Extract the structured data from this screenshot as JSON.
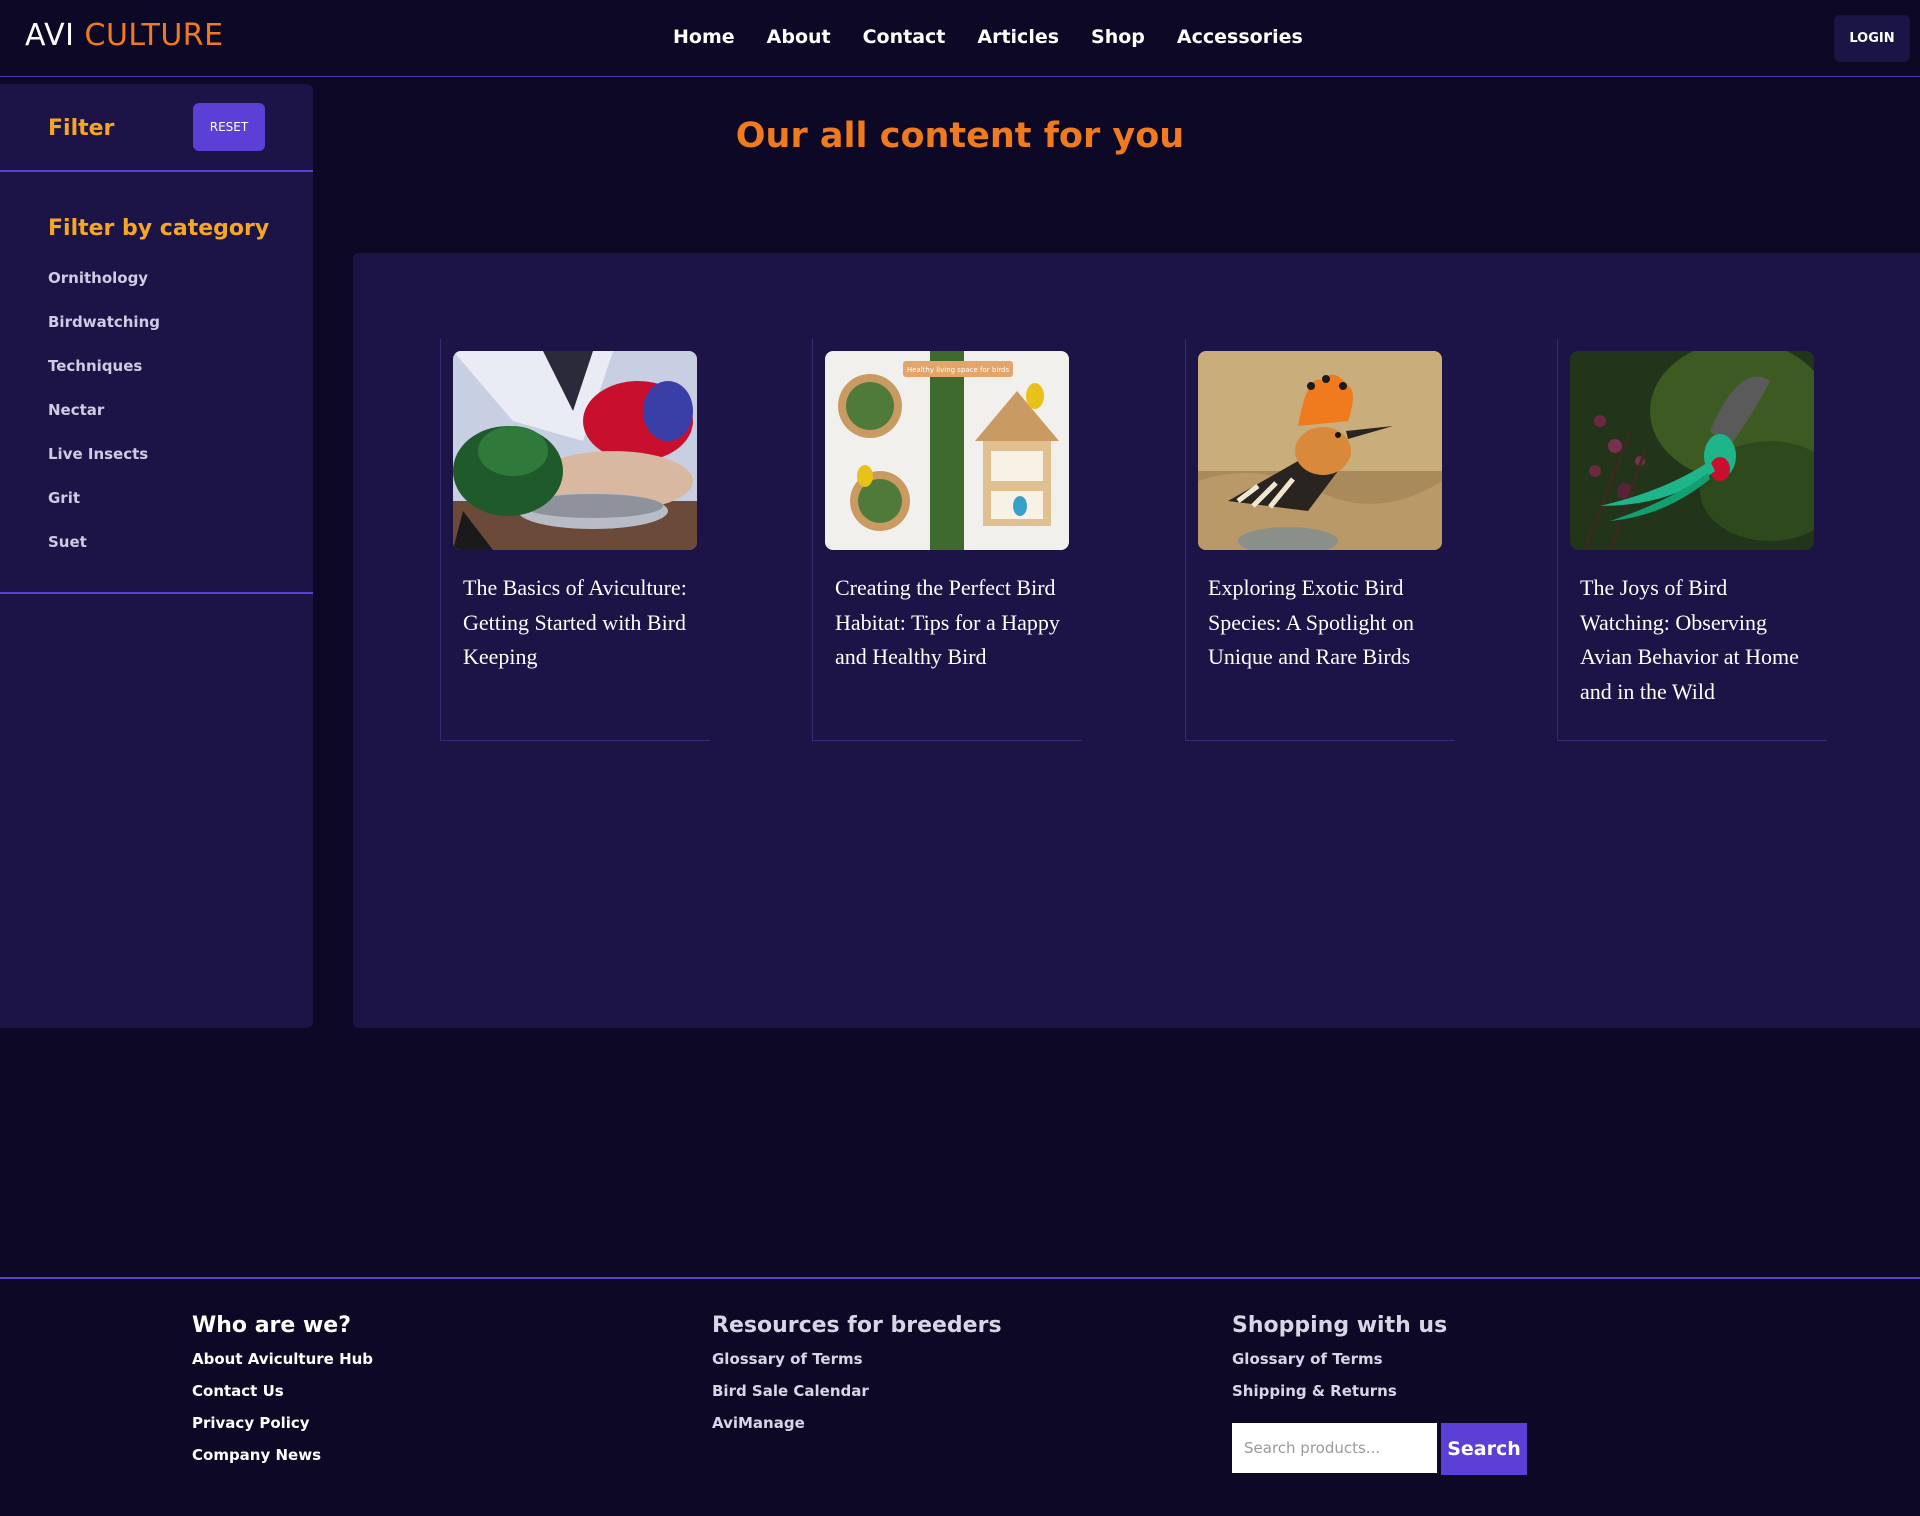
{
  "header": {
    "logo_part1": "AVI",
    "logo_part2": "CULTURE",
    "nav": [
      "Home",
      "About",
      "Contact",
      "Articles",
      "Shop",
      "Accessories"
    ],
    "login_label": "LOGIN"
  },
  "sidebar": {
    "filter_title": "Filter",
    "reset_label": "RESET",
    "category_title": "Filter by category",
    "categories": [
      "Ornithology",
      "Birdwatching",
      "Techniques",
      "Nectar",
      "Live Insects",
      "Grit",
      "Suet"
    ]
  },
  "main": {
    "title": "Our all content for you",
    "articles": [
      {
        "title": "The Basics of Aviculture: Getting Started with Bird Keeping",
        "image": "parrots-feeding-image"
      },
      {
        "title": "Creating the Perfect Bird Habitat: Tips for a Happy and Healthy Bird",
        "image": "bird-habitat-image",
        "image_caption": "Healthy living space for birds"
      },
      {
        "title": "Exploring Exotic Bird Species: A Spotlight on Unique and Rare Birds",
        "image": "hoopoe-image"
      },
      {
        "title": "The Joys of Bird Watching: Observing Avian Behavior at Home and in the Wild",
        "image": "quetzal-image"
      }
    ]
  },
  "footer": {
    "col1": {
      "title": "Who are we?",
      "links": [
        "About Aviculture Hub",
        "Contact Us",
        "Privacy Policy",
        "Company News"
      ]
    },
    "col2": {
      "title": "Resources for breeders",
      "links": [
        "Glossary of Terms",
        "Bird Sale Calendar",
        "AviManage"
      ]
    },
    "col3": {
      "title": "Shopping with us",
      "links": [
        "Glossary of Terms",
        "Shipping & Returns"
      ]
    },
    "search": {
      "placeholder": "Search products...",
      "button_label": "Search"
    }
  },
  "colors": {
    "background": "#0c0825",
    "panel": "#1c1447",
    "accent_orange": "#f07a1e",
    "accent_yellow": "#f5a623",
    "accent_purple": "#5b3fd6"
  }
}
